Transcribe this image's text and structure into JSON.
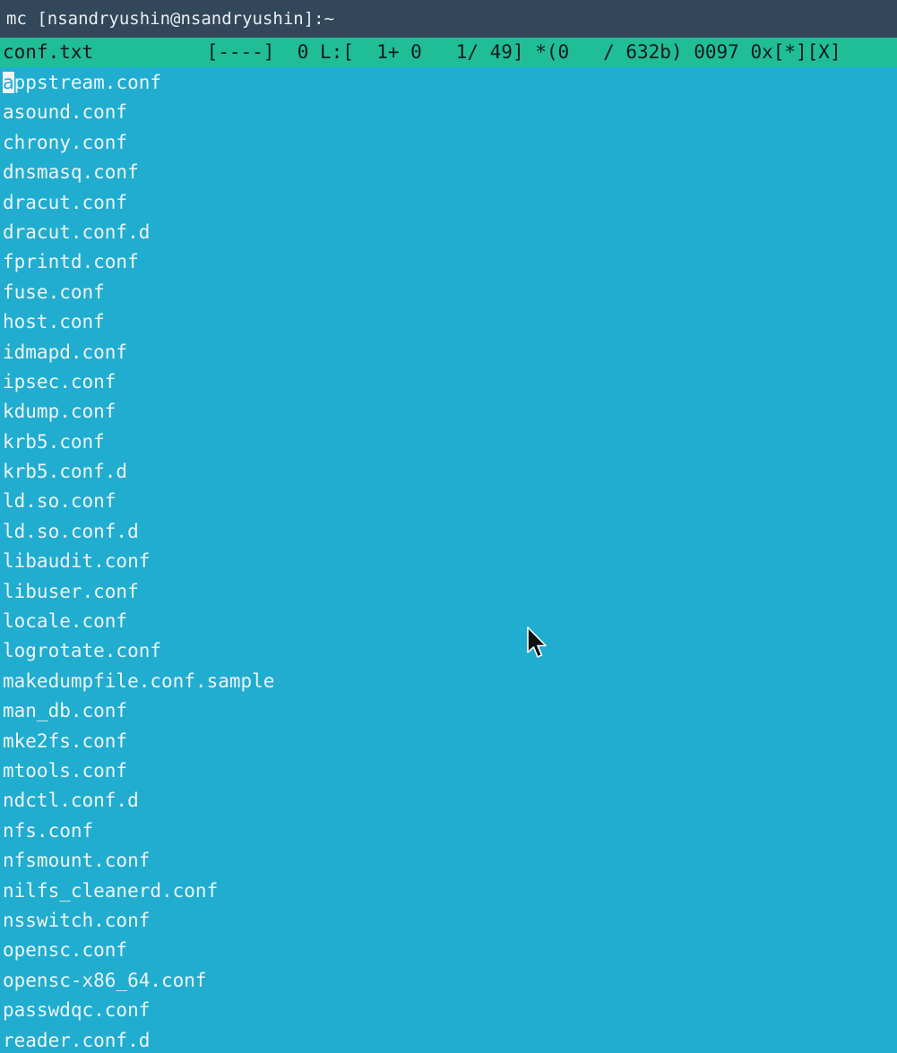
{
  "window": {
    "title": "mc [nsandryushin@nsandryushin]:~"
  },
  "status": {
    "text": "conf.txt          [----]  0 L:[  1+ 0   1/ 49] *(0   / 632b) 0097 0x[*][X]"
  },
  "editor": {
    "cursor_char": "a",
    "first_line_rest": "ppstream.conf",
    "lines": [
      "asound.conf",
      "chrony.conf",
      "dnsmasq.conf",
      "dracut.conf",
      "dracut.conf.d",
      "fprintd.conf",
      "fuse.conf",
      "host.conf",
      "idmapd.conf",
      "ipsec.conf",
      "kdump.conf",
      "krb5.conf",
      "krb5.conf.d",
      "ld.so.conf",
      "ld.so.conf.d",
      "libaudit.conf",
      "libuser.conf",
      "locale.conf",
      "logrotate.conf",
      "makedumpfile.conf.sample",
      "man_db.conf",
      "mke2fs.conf",
      "mtools.conf",
      "ndctl.conf.d",
      "nfs.conf",
      "nfsmount.conf",
      "nilfs_cleanerd.conf",
      "nsswitch.conf",
      "opensc.conf",
      "opensc-x86_64.conf",
      "passwdqc.conf",
      "reader.conf.d"
    ]
  },
  "colors": {
    "title_bg": "#33475a",
    "status_bg": "#1fbe96",
    "editor_bg": "#20adcf",
    "text": "#eef4f6"
  }
}
